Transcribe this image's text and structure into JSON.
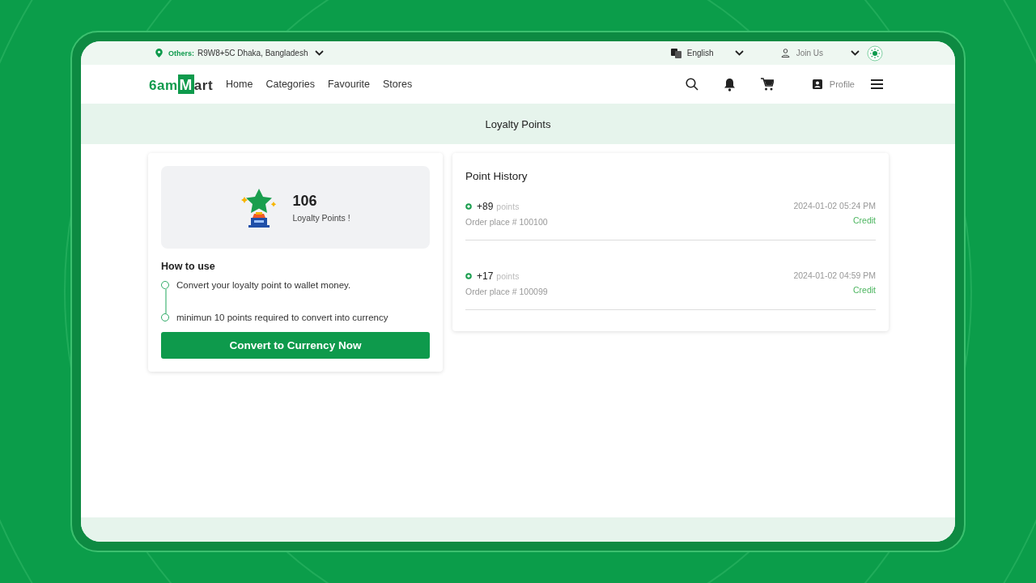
{
  "top_bar": {
    "location_label": "Others:",
    "location": "R9W8+5C Dhaka, Bangladesh",
    "language": "English",
    "account": "Join Us"
  },
  "nav": {
    "logo_prefix": "6am",
    "logo_mark": "M",
    "logo_suffix": "art",
    "links": [
      "Home",
      "Categories",
      "Favourite",
      "Stores"
    ],
    "profile": "Profile"
  },
  "banner": {
    "title": "Loyalty Points"
  },
  "points_card": {
    "points": "106",
    "points_label": "Loyalty Points !",
    "how_to_title": "How to use",
    "steps": [
      "Convert your loyalty point to wallet money.",
      "minimun 10 points required to convert into currency"
    ],
    "button": "Convert to Currency Now"
  },
  "history": {
    "title": "Point History",
    "entries": [
      {
        "amount": "+89",
        "unit": "points",
        "description": "Order place # 100100",
        "date": "2024-01-02 05:24 PM",
        "type": "Credit"
      },
      {
        "amount": "+17",
        "unit": "points",
        "description": "Order place # 100099",
        "date": "2024-01-02 04:59 PM",
        "type": "Credit"
      }
    ]
  }
}
